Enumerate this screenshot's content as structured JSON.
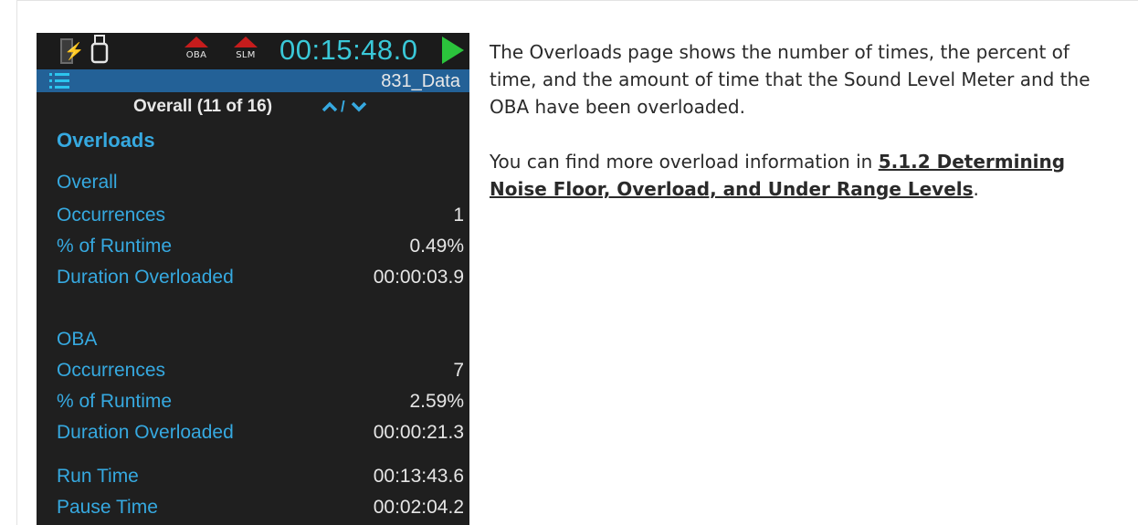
{
  "status_bar": {
    "indicators": [
      {
        "label": "OBA",
        "icon": "overload-triangle-icon",
        "color": "#c61c1c"
      },
      {
        "label": "SLM",
        "icon": "overload-triangle-icon",
        "color": "#c61c1c"
      }
    ],
    "run_clock": "00:15:48.0",
    "battery_icon": "battery-charging-icon",
    "usb_icon": "usb-icon",
    "play_icon": "play-icon"
  },
  "title_bar": {
    "menu_icon": "menu-list-icon",
    "file_name": "831_Data"
  },
  "page_nav": {
    "label": "Overall (11 of 16)",
    "separator": "/"
  },
  "section_title": "Overloads",
  "overall": {
    "label": "Overall",
    "rows": [
      {
        "label": "Occurrences",
        "value": "1"
      },
      {
        "label": "% of Runtime",
        "value": "0.49%"
      },
      {
        "label": "Duration Overloaded",
        "value": "00:00:03.9"
      }
    ]
  },
  "oba": {
    "label": "OBA",
    "rows": [
      {
        "label": "Occurrences",
        "value": "7"
      },
      {
        "label": "% of Runtime",
        "value": "2.59%"
      },
      {
        "label": "Duration Overloaded",
        "value": "00:00:21.3"
      }
    ]
  },
  "times": [
    {
      "label": "Run Time",
      "value": "00:13:43.6"
    },
    {
      "label": "Pause Time",
      "value": "00:02:04.2"
    }
  ],
  "description": {
    "para1": "The Overloads page shows the number of times, the percent of time, and the amount of time that the Sound Level Meter and the OBA have been overloaded.",
    "para2_prefix": "You can find more overload information in ",
    "link_text": "5.1.2 Determining Noise Floor, Overload, and Under Range Levels",
    "para2_suffix": "."
  },
  "colors": {
    "accent": "#36a9e0",
    "title_bar": "#236197",
    "screen_bg": "#1f1f1f",
    "clock": "#3ac8d8",
    "play": "#2bc43c",
    "alert": "#c61c1c"
  }
}
